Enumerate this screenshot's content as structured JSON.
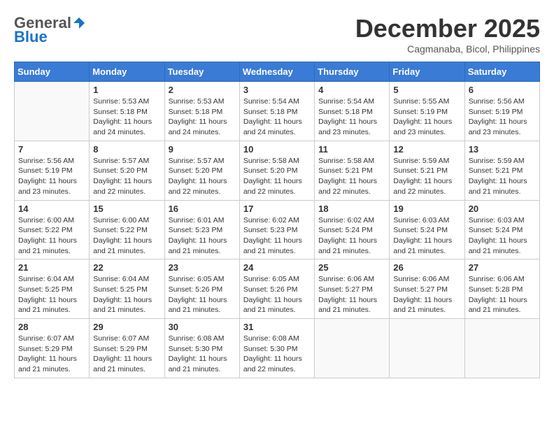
{
  "header": {
    "logo_general": "General",
    "logo_blue": "Blue",
    "month_title": "December 2025",
    "location": "Cagmanaba, Bicol, Philippines"
  },
  "weekdays": [
    "Sunday",
    "Monday",
    "Tuesday",
    "Wednesday",
    "Thursday",
    "Friday",
    "Saturday"
  ],
  "weeks": [
    [
      {
        "day": "",
        "info": ""
      },
      {
        "day": "1",
        "info": "Sunrise: 5:53 AM\nSunset: 5:18 PM\nDaylight: 11 hours\nand 24 minutes."
      },
      {
        "day": "2",
        "info": "Sunrise: 5:53 AM\nSunset: 5:18 PM\nDaylight: 11 hours\nand 24 minutes."
      },
      {
        "day": "3",
        "info": "Sunrise: 5:54 AM\nSunset: 5:18 PM\nDaylight: 11 hours\nand 24 minutes."
      },
      {
        "day": "4",
        "info": "Sunrise: 5:54 AM\nSunset: 5:18 PM\nDaylight: 11 hours\nand 23 minutes."
      },
      {
        "day": "5",
        "info": "Sunrise: 5:55 AM\nSunset: 5:19 PM\nDaylight: 11 hours\nand 23 minutes."
      },
      {
        "day": "6",
        "info": "Sunrise: 5:56 AM\nSunset: 5:19 PM\nDaylight: 11 hours\nand 23 minutes."
      }
    ],
    [
      {
        "day": "7",
        "info": "Sunrise: 5:56 AM\nSunset: 5:19 PM\nDaylight: 11 hours\nand 23 minutes."
      },
      {
        "day": "8",
        "info": "Sunrise: 5:57 AM\nSunset: 5:20 PM\nDaylight: 11 hours\nand 22 minutes."
      },
      {
        "day": "9",
        "info": "Sunrise: 5:57 AM\nSunset: 5:20 PM\nDaylight: 11 hours\nand 22 minutes."
      },
      {
        "day": "10",
        "info": "Sunrise: 5:58 AM\nSunset: 5:20 PM\nDaylight: 11 hours\nand 22 minutes."
      },
      {
        "day": "11",
        "info": "Sunrise: 5:58 AM\nSunset: 5:21 PM\nDaylight: 11 hours\nand 22 minutes."
      },
      {
        "day": "12",
        "info": "Sunrise: 5:59 AM\nSunset: 5:21 PM\nDaylight: 11 hours\nand 22 minutes."
      },
      {
        "day": "13",
        "info": "Sunrise: 5:59 AM\nSunset: 5:21 PM\nDaylight: 11 hours\nand 21 minutes."
      }
    ],
    [
      {
        "day": "14",
        "info": "Sunrise: 6:00 AM\nSunset: 5:22 PM\nDaylight: 11 hours\nand 21 minutes."
      },
      {
        "day": "15",
        "info": "Sunrise: 6:00 AM\nSunset: 5:22 PM\nDaylight: 11 hours\nand 21 minutes."
      },
      {
        "day": "16",
        "info": "Sunrise: 6:01 AM\nSunset: 5:23 PM\nDaylight: 11 hours\nand 21 minutes."
      },
      {
        "day": "17",
        "info": "Sunrise: 6:02 AM\nSunset: 5:23 PM\nDaylight: 11 hours\nand 21 minutes."
      },
      {
        "day": "18",
        "info": "Sunrise: 6:02 AM\nSunset: 5:24 PM\nDaylight: 11 hours\nand 21 minutes."
      },
      {
        "day": "19",
        "info": "Sunrise: 6:03 AM\nSunset: 5:24 PM\nDaylight: 11 hours\nand 21 minutes."
      },
      {
        "day": "20",
        "info": "Sunrise: 6:03 AM\nSunset: 5:24 PM\nDaylight: 11 hours\nand 21 minutes."
      }
    ],
    [
      {
        "day": "21",
        "info": "Sunrise: 6:04 AM\nSunset: 5:25 PM\nDaylight: 11 hours\nand 21 minutes."
      },
      {
        "day": "22",
        "info": "Sunrise: 6:04 AM\nSunset: 5:25 PM\nDaylight: 11 hours\nand 21 minutes."
      },
      {
        "day": "23",
        "info": "Sunrise: 6:05 AM\nSunset: 5:26 PM\nDaylight: 11 hours\nand 21 minutes."
      },
      {
        "day": "24",
        "info": "Sunrise: 6:05 AM\nSunset: 5:26 PM\nDaylight: 11 hours\nand 21 minutes."
      },
      {
        "day": "25",
        "info": "Sunrise: 6:06 AM\nSunset: 5:27 PM\nDaylight: 11 hours\nand 21 minutes."
      },
      {
        "day": "26",
        "info": "Sunrise: 6:06 AM\nSunset: 5:27 PM\nDaylight: 11 hours\nand 21 minutes."
      },
      {
        "day": "27",
        "info": "Sunrise: 6:06 AM\nSunset: 5:28 PM\nDaylight: 11 hours\nand 21 minutes."
      }
    ],
    [
      {
        "day": "28",
        "info": "Sunrise: 6:07 AM\nSunset: 5:29 PM\nDaylight: 11 hours\nand 21 minutes."
      },
      {
        "day": "29",
        "info": "Sunrise: 6:07 AM\nSunset: 5:29 PM\nDaylight: 11 hours\nand 21 minutes."
      },
      {
        "day": "30",
        "info": "Sunrise: 6:08 AM\nSunset: 5:30 PM\nDaylight: 11 hours\nand 21 minutes."
      },
      {
        "day": "31",
        "info": "Sunrise: 6:08 AM\nSunset: 5:30 PM\nDaylight: 11 hours\nand 22 minutes."
      },
      {
        "day": "",
        "info": ""
      },
      {
        "day": "",
        "info": ""
      },
      {
        "day": "",
        "info": ""
      }
    ]
  ]
}
